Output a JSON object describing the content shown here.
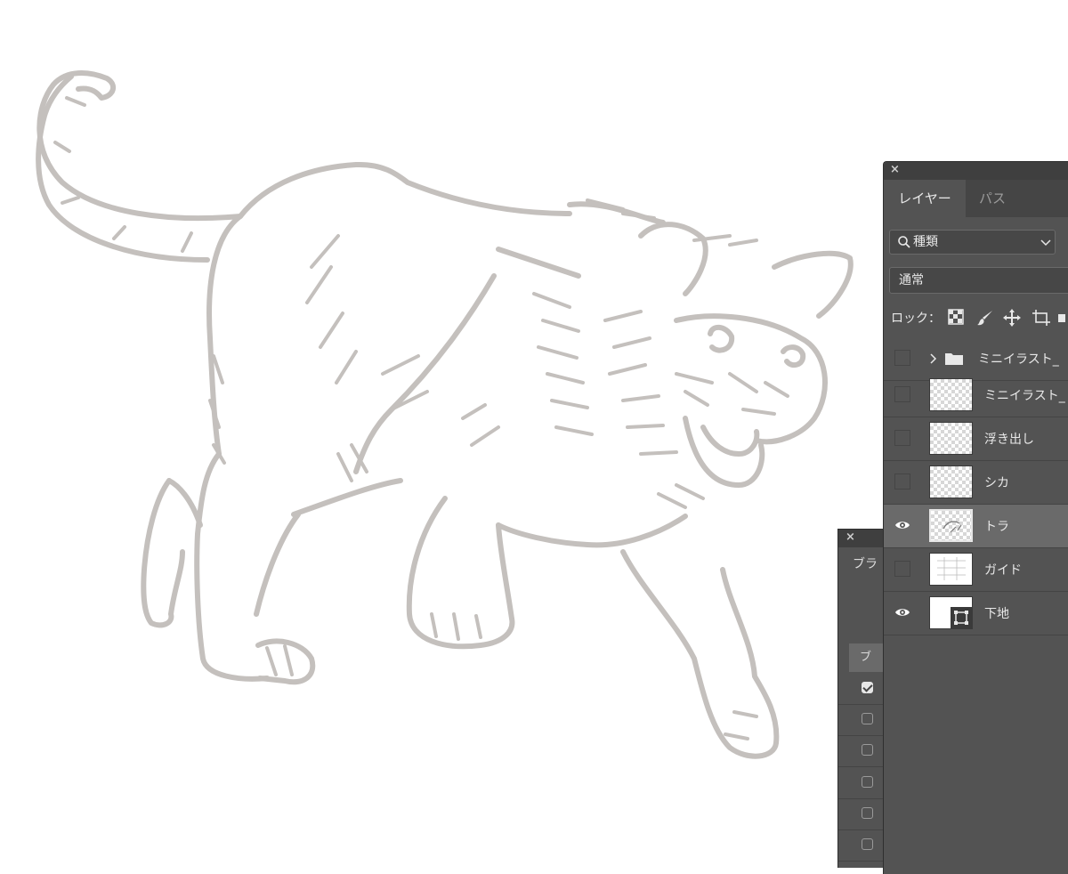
{
  "brush_panel": {
    "close": "×",
    "tab_label": "ブラ",
    "subheader": "ブ",
    "checkboxes": [
      true,
      false,
      false,
      false,
      false,
      false
    ]
  },
  "layers_panel": {
    "close": "×",
    "tabs": [
      {
        "label": "レイヤー",
        "active": true
      },
      {
        "label": "パス",
        "active": false
      }
    ],
    "filter": {
      "icon": "search-icon",
      "label": "種類",
      "chevron": "⌵"
    },
    "blend_mode": "通常",
    "lock_label": "ロック：",
    "lock_icons": [
      "lock-transparent-pixels-icon",
      "lock-image-pixels-icon",
      "lock-position-icon",
      "lock-artboard-icon"
    ],
    "layers": [
      {
        "name": "ミニイラスト_",
        "type": "group",
        "visible": false,
        "selected": false
      },
      {
        "name": "ミニイラスト_",
        "type": "layer",
        "visible": false,
        "selected": false
      },
      {
        "name": "浮き出し",
        "type": "layer",
        "visible": false,
        "selected": false
      },
      {
        "name": "シカ",
        "type": "layer",
        "visible": false,
        "selected": false
      },
      {
        "name": "トラ",
        "type": "layer",
        "visible": true,
        "selected": true
      },
      {
        "name": "ガイド",
        "type": "layer",
        "visible": false,
        "selected": false
      },
      {
        "name": "下地",
        "type": "shape",
        "visible": true,
        "selected": false
      }
    ]
  },
  "colors": {
    "panel_bg": "#535353",
    "panel_dark": "#3f3f3f",
    "selected_row": "#6a6a6a",
    "drawing_stroke": "#c4c0bd"
  }
}
